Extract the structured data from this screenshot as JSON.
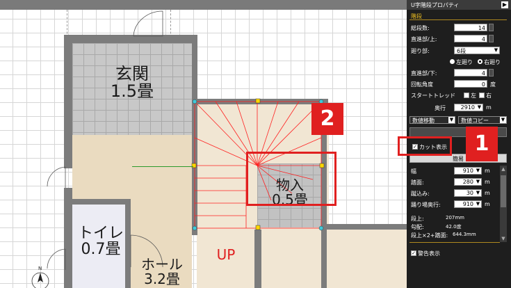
{
  "panel": {
    "title": "U字階段プロパティ",
    "section": "階段",
    "rows": {
      "step_count_label": "総段数:",
      "step_count_value": "14",
      "straight_top_label": "直進部/上:",
      "straight_top_value": "4",
      "turn_label": "廻り部:",
      "turn_value": "6段",
      "dir_left": "左廻り",
      "dir_right": "右廻り",
      "straight_bottom_label": "直進部/下:",
      "straight_bottom_value": "4",
      "rotation_label": "回転角度",
      "rotation_value": "0",
      "rotation_unit": "度",
      "start_label": "スタートトレッド",
      "start_left": "左",
      "start_right": "右",
      "depth_label": "奥行",
      "depth_value": "2910",
      "depth_unit": "m",
      "move_label": "数値移動",
      "copy_label": "数値コピー",
      "cut_label": "カット表示",
      "simple_label": "簡易",
      "width_label": "幅",
      "width_value": "910",
      "width_unit": "m",
      "tread_label": "踏面:",
      "tread_value": "280",
      "tread_unit": "m",
      "nosing_label": "蹴込み:",
      "nosing_value": "30",
      "nosing_unit": "m",
      "landing_label": "踊り場奥行:",
      "landing_value": "910",
      "landing_unit": "m",
      "rise_label": "段上:",
      "rise_value": "207mm",
      "slope_label": "勾配:",
      "slope_value": "42.0度",
      "formula_label": "段上×2+踏面:",
      "formula_value": "644.3mm",
      "warn_label": "警告表示"
    }
  },
  "plan": {
    "entrance_name": "玄関",
    "entrance_size": "1.5畳",
    "toilet_name": "トイレ",
    "toilet_size": "0.7畳",
    "hall_name": "ホール",
    "hall_size": "3.2畳",
    "storage_name": "物入",
    "storage_size": "0.5畳",
    "up_label": "UP"
  },
  "annotations": {
    "badge1": "1",
    "badge2": "2"
  },
  "colors": {
    "highlight": "#e02020",
    "wall": "#7c7c7c",
    "floor": "#eadbc0",
    "stair_line": "#ff2020"
  }
}
